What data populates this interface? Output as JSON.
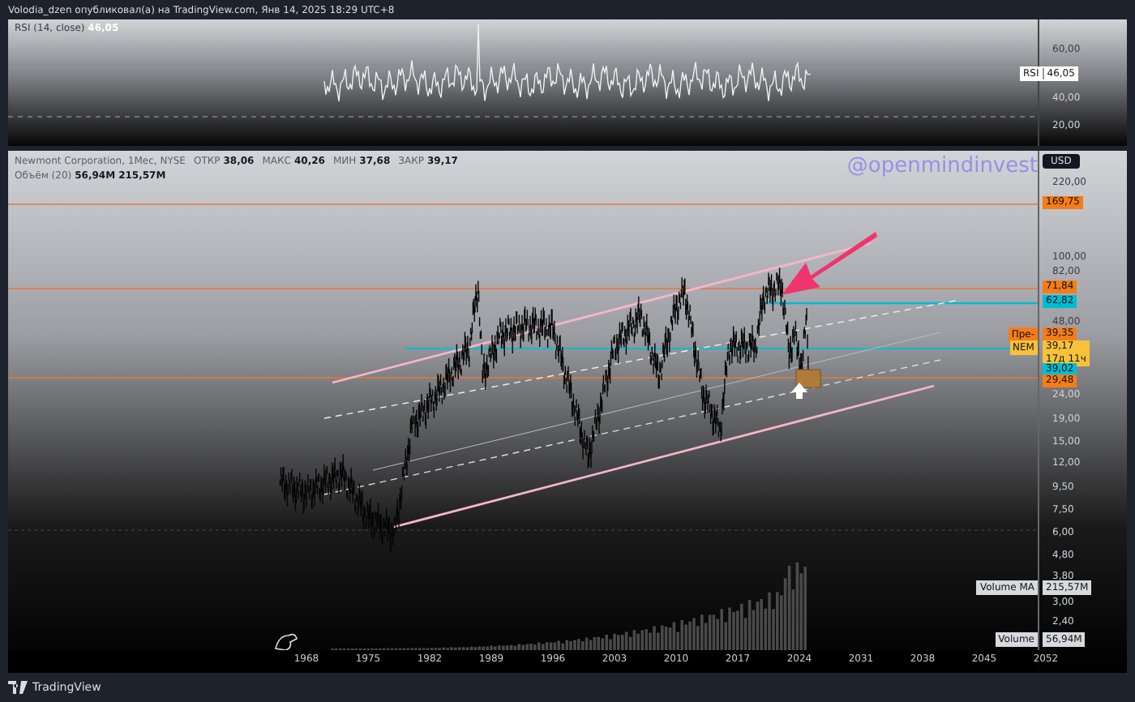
{
  "header": {
    "text": "Volodia_dzen опубликовал(а) на TradingView.com, Янв 14, 2025 18:29 UTC+8"
  },
  "rsi_panel": {
    "legend": "RSI (14, close)",
    "value": "46,05",
    "axis_labels": [
      "60,00",
      "40,00",
      "20,00"
    ],
    "tag": {
      "label": "RSI",
      "value": "46,05"
    }
  },
  "legend": {
    "symbol": "Newmont Corporation, 1Мес, NYSE",
    "ohlc": [
      {
        "label": "ОТКР",
        "value": "38,06"
      },
      {
        "label": "МАКС",
        "value": "40,26"
      },
      {
        "label": "МИН",
        "value": "37,68"
      },
      {
        "label": "ЗАКР",
        "value": "39,17"
      }
    ]
  },
  "volume_legend": {
    "label": "Объём (20)",
    "values": [
      "56,94M",
      "215,57M"
    ]
  },
  "watermark_text": "@openmindinvest",
  "currency_button": "USD",
  "price_axis_labels": [
    "220,00",
    "100,00",
    "82,00",
    "48,00",
    "24,00",
    "19,00",
    "15,00",
    "12,00",
    "9,50",
    "7,50",
    "6,00",
    "4,80",
    "3,80",
    "3,00",
    "2,40"
  ],
  "price_tags": [
    {
      "value": "169,75",
      "color": "#f57c17"
    },
    {
      "value": "71,84",
      "color": "#f57c17"
    },
    {
      "value": "62,82",
      "color": "#00bcd4"
    },
    {
      "value": "39,35",
      "prefix": "Пре-",
      "color": "#f57c17"
    },
    {
      "value": "39,17",
      "sub": "17д 11ч",
      "prefix": "NEM",
      "color": "#f7c23a"
    },
    {
      "value": "39,02",
      "color": "#00bcd4"
    },
    {
      "value": "29,48",
      "color": "#f57c17"
    }
  ],
  "volume_tags": [
    {
      "label": "Volume MA",
      "value": "215,57M"
    },
    {
      "label": "Volume",
      "value": "56,94M"
    }
  ],
  "time_axis_labels": [
    "1968",
    "1975",
    "1982",
    "1989",
    "1996",
    "2003",
    "2010",
    "2017",
    "2024",
    "2031",
    "2038",
    "2045",
    "2052"
  ],
  "footer": {
    "logo_text": "TradingView"
  }
}
